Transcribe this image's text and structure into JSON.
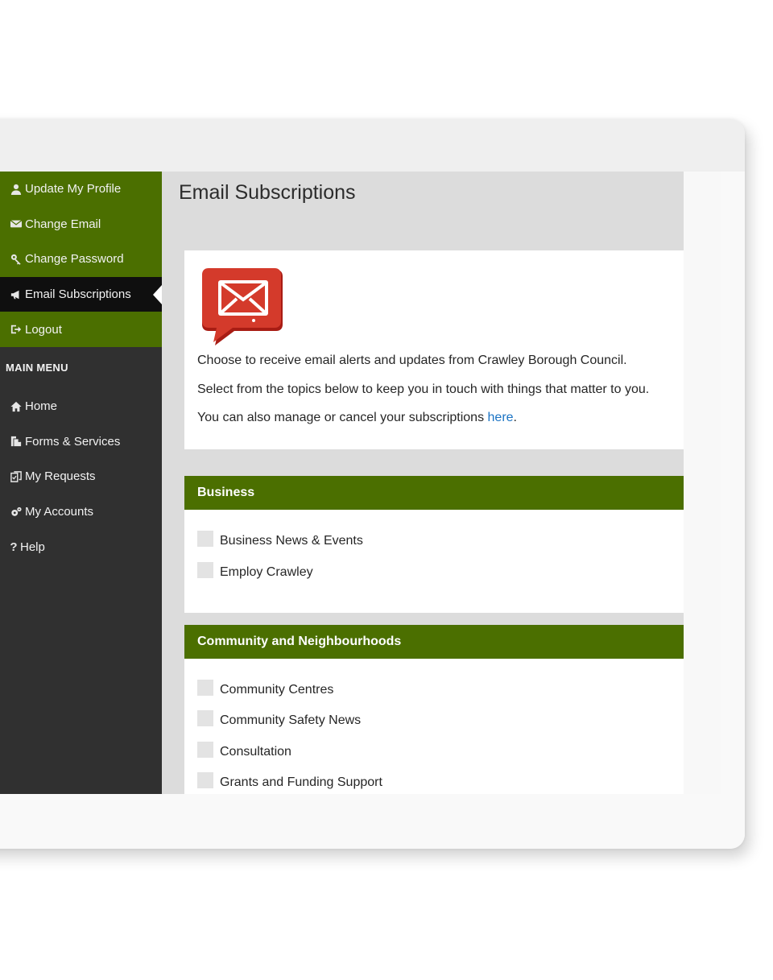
{
  "sidebar": {
    "account_items": [
      {
        "label": "Update My Profile",
        "icon": "user-icon"
      },
      {
        "label": "Change Email",
        "icon": "envelope-icon"
      },
      {
        "label": "Change Password",
        "icon": "key-icon"
      },
      {
        "label": "Email Subscriptions",
        "icon": "megaphone-icon",
        "active": true
      },
      {
        "label": "Logout",
        "icon": "logout-icon"
      }
    ],
    "main_menu_heading": "MAIN MENU",
    "main_menu_items": [
      {
        "label": "Home",
        "icon": "home-icon"
      },
      {
        "label": "Forms & Services",
        "icon": "documents-icon"
      },
      {
        "label": "My Requests",
        "icon": "clipboard-icon"
      },
      {
        "label": "My Accounts",
        "icon": "gears-icon"
      },
      {
        "label": "Help",
        "icon": "question-icon"
      }
    ]
  },
  "main": {
    "title": "Email Subscriptions",
    "intro": {
      "logo_icon": "email-speech-bubble-logo",
      "line1": "Choose to receive email alerts and updates from Crawley Borough Council.",
      "line2": "Select from the topics below to keep you in touch with things that matter to you.",
      "line3_prefix": "You can also manage or cancel your subscriptions ",
      "line3_link": "here",
      "line3_suffix": "."
    },
    "sections": [
      {
        "heading": "Business",
        "options": [
          "Business News & Events",
          "Employ Crawley"
        ]
      },
      {
        "heading": "Community and Neighbourhoods",
        "options": [
          "Community Centres",
          "Community Safety News",
          "Consultation",
          "Grants and Funding Support"
        ]
      }
    ]
  },
  "colors": {
    "green": "#4b6f00",
    "sidebar_dark": "#303030",
    "active_item": "#0f0f0f",
    "link": "#1a73c4",
    "logo_red": "#c8281e"
  }
}
